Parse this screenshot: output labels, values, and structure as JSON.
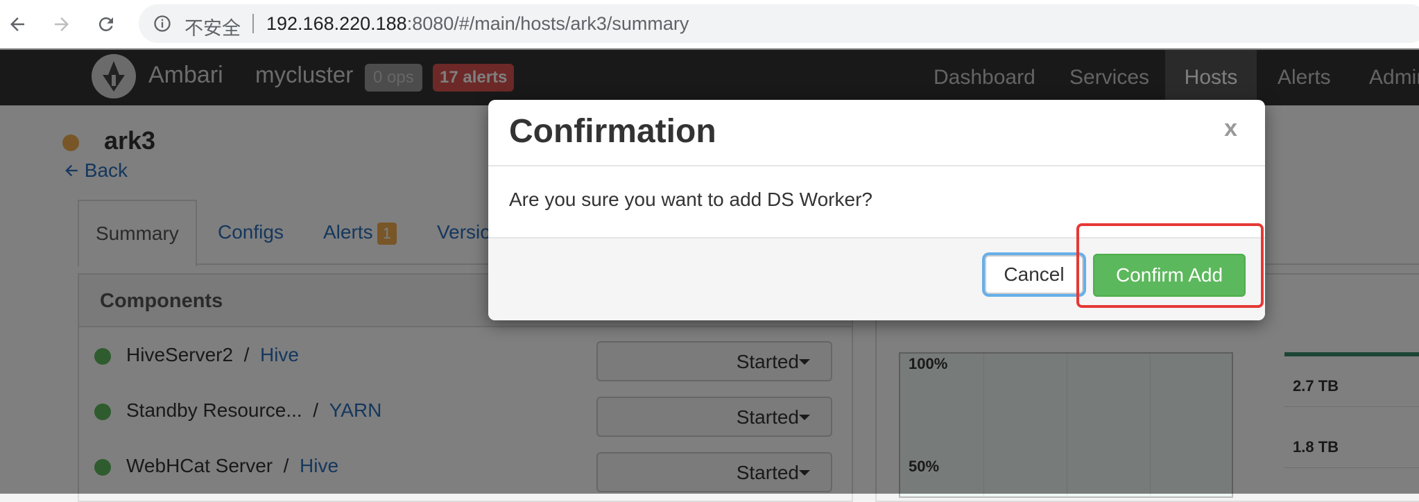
{
  "browser": {
    "security_label": "不安全",
    "url_host": "192.168.220.188",
    "url_rest": ":8080/#/main/hosts/ark3/summary"
  },
  "header": {
    "app_name": "Ambari",
    "cluster_name": "mycluster",
    "ops_badge": "0 ops",
    "alerts_badge": "17 alerts",
    "nav": [
      {
        "label": "Dashboard",
        "active": false
      },
      {
        "label": "Services",
        "active": false
      },
      {
        "label": "Hosts",
        "active": true
      },
      {
        "label": "Alerts",
        "active": false
      },
      {
        "label": "Admin",
        "active": false
      }
    ]
  },
  "host": {
    "name": "ark3",
    "back_label": "Back"
  },
  "tabs": [
    {
      "label": "Summary",
      "active": true
    },
    {
      "label": "Configs",
      "active": false
    },
    {
      "label": "Alerts",
      "active": false,
      "badge": "1"
    },
    {
      "label": "Versio",
      "active": false
    }
  ],
  "components": {
    "title": "Components",
    "rows": [
      {
        "name": "HiveServer2",
        "separator": "/",
        "service": "Hive",
        "state": "Started"
      },
      {
        "name": "Standby Resource...",
        "separator": "/",
        "service": "YARN",
        "state": "Started"
      },
      {
        "name": "WebHCat Server",
        "separator": "/",
        "service": "Hive",
        "state": "Started"
      }
    ]
  },
  "metrics": {
    "cpu_labels": [
      "100%",
      "50%"
    ],
    "disk_labels": [
      "2.7 TB",
      "1.8 TB"
    ]
  },
  "modal": {
    "title": "Confirmation",
    "close_label": "x",
    "message": "Are you sure you want to add DS Worker?",
    "cancel_label": "Cancel",
    "confirm_label": "Confirm Add"
  },
  "colors": {
    "header_bg": "#333333",
    "link": "#2a6ebb",
    "success": "#5cb85c",
    "danger": "#d9534f",
    "annotation": "#e53935"
  }
}
